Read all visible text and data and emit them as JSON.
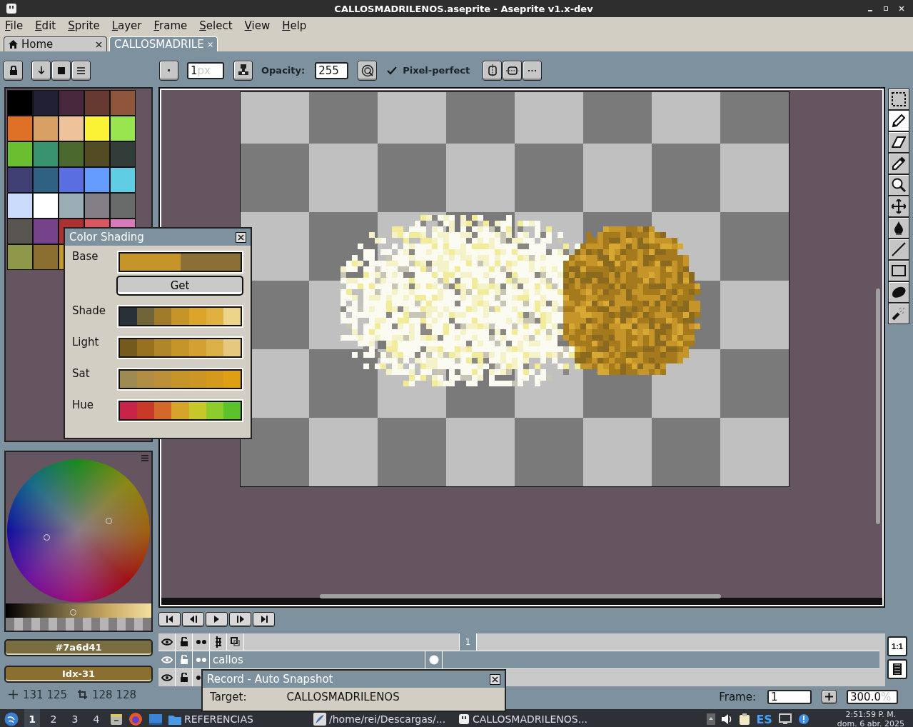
{
  "window": {
    "title": "CALLOSMADRILENOS.aseprite - Aseprite v1.x-dev"
  },
  "menu": [
    "File",
    "Edit",
    "Sprite",
    "Layer",
    "Frame",
    "Select",
    "View",
    "Help"
  ],
  "tabs": [
    {
      "label": "Home",
      "kind": "home",
      "selected": false
    },
    {
      "label": "CALLOSMADRILE",
      "kind": "document",
      "selected": true
    }
  ],
  "toolbar": {
    "brush_size": "1",
    "brush_unit": "px",
    "opacity_label": "Opacity:",
    "opacity": "255",
    "pixel_perfect": {
      "label": "Pixel-perfect",
      "checked": true
    }
  },
  "palette": [
    {
      "color": "#000000"
    },
    {
      "color": "#222034"
    },
    {
      "color": "#45283c"
    },
    {
      "color": "#663931"
    },
    {
      "color": "#8f563b"
    },
    {
      "color": "#df7126"
    },
    {
      "color": "#d9a066"
    },
    {
      "color": "#eec39a"
    },
    {
      "color": "#fbf236"
    },
    {
      "color": "#99e550"
    },
    {
      "color": "#6abe30"
    },
    {
      "color": "#37946e"
    },
    {
      "color": "#4b692f"
    },
    {
      "color": "#524b24"
    },
    {
      "color": "#323c39"
    },
    {
      "color": "#3f3f74"
    },
    {
      "color": "#306082"
    },
    {
      "color": "#5b6ee1"
    },
    {
      "color": "#639bff"
    },
    {
      "color": "#5fcde4"
    },
    {
      "color": "#cbdbfc"
    },
    {
      "color": "#ffffff"
    },
    {
      "color": "#9badb7"
    },
    {
      "color": "#847e87"
    },
    {
      "color": "#696a6a"
    },
    {
      "color": "#595652"
    },
    {
      "color": "#76428a"
    },
    {
      "color": "#ac3232"
    },
    {
      "color": "#d95763"
    },
    {
      "color": "#d77bba"
    },
    {
      "color": "#8f974a"
    },
    {
      "color": "#8a6f30"
    },
    {
      "color": "#c69a2a"
    }
  ],
  "color_shading": {
    "title": "Color Shading",
    "base": {
      "label": "Base",
      "swatches": [
        {
          "color": "#c6952a"
        },
        {
          "color": "#8a6f36"
        }
      ]
    },
    "get_button": "Get",
    "ramps": [
      {
        "label": "Shade",
        "swatches": [
          {
            "color": "#283038"
          },
          {
            "color": "#6f6538"
          },
          {
            "color": "#a07c2a"
          },
          {
            "color": "#c6952a"
          },
          {
            "color": "#dba52a"
          },
          {
            "color": "#e0b040"
          },
          {
            "color": "#ecd48a"
          }
        ]
      },
      {
        "label": "Light",
        "swatches": [
          {
            "color": "#755a1e"
          },
          {
            "color": "#977020"
          },
          {
            "color": "#b0862a"
          },
          {
            "color": "#c6952a"
          },
          {
            "color": "#d4a032"
          },
          {
            "color": "#dcb048"
          },
          {
            "color": "#e6c880"
          }
        ]
      },
      {
        "label": "Sat",
        "swatches": [
          {
            "color": "#9e8a52"
          },
          {
            "color": "#b08e44"
          },
          {
            "color": "#bc9038"
          },
          {
            "color": "#c6952a"
          },
          {
            "color": "#cc9624"
          },
          {
            "color": "#d49a1c"
          },
          {
            "color": "#dea012"
          }
        ]
      },
      {
        "label": "Hue",
        "swatches": [
          {
            "color": "#c8244a"
          },
          {
            "color": "#c83a28"
          },
          {
            "color": "#d2682a"
          },
          {
            "color": "#d6a42a"
          },
          {
            "color": "#c6c82a"
          },
          {
            "color": "#8ccc2c"
          },
          {
            "color": "#5cc22c"
          }
        ]
      }
    ]
  },
  "color_fields": [
    {
      "text": "#7a6d41",
      "color": "#7a6d41"
    },
    {
      "text": "Idx-31",
      "color": "#8a6f30"
    }
  ],
  "status": {
    "position": "131 125",
    "size": "128 128"
  },
  "tools": [
    {
      "kind": "marquee",
      "selected": false
    },
    {
      "kind": "pencil",
      "selected": true
    },
    {
      "kind": "eraser",
      "selected": false
    },
    {
      "kind": "eyedropper",
      "selected": false
    },
    {
      "kind": "zoom",
      "selected": false
    },
    {
      "kind": "move",
      "selected": false
    },
    {
      "kind": "bucket",
      "selected": false
    },
    {
      "kind": "line",
      "selected": false
    },
    {
      "kind": "rectangle",
      "selected": false
    },
    {
      "kind": "blob",
      "selected": false
    },
    {
      "kind": "spray",
      "selected": false
    }
  ],
  "timeline": {
    "frame_header": "1",
    "zoom_reset": "1:1",
    "layers": [
      {
        "name": "callos",
        "selected": true,
        "has_cel": true
      },
      {
        "selected": false
      }
    ]
  },
  "frame_bar": {
    "label": "Frame:",
    "frame": "1",
    "zoom": "300.0",
    "zoom_unit": "%"
  },
  "record_dialog": {
    "title": "Record - Auto Snapshot",
    "target_label": "Target:",
    "target": "CALLOSMADRILENOS"
  },
  "taskbar": {
    "workspaces": [
      {
        "label": "1",
        "selected": true
      },
      {
        "label": "2",
        "selected": false
      },
      {
        "label": "3",
        "selected": false
      },
      {
        "label": "4",
        "selected": false
      }
    ],
    "tasks": [
      {
        "label": "REFERENCIAS",
        "kind": "folder"
      },
      {
        "label": "/home/rei/Descargas/...",
        "kind": "editor"
      },
      {
        "label": "CALLOSMADRILENOS...",
        "kind": "app"
      }
    ],
    "language": "ES",
    "time": "2:51:59 P. M.",
    "date": "dom. 6 abr. 2025"
  }
}
